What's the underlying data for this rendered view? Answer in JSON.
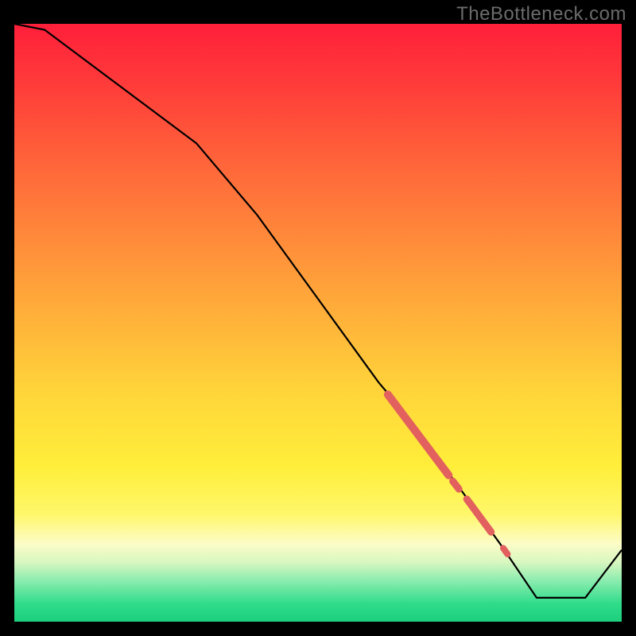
{
  "watermark": "TheBottleneck.com",
  "colors": {
    "line": "#000000",
    "marker": "#e2605e",
    "bg_top": "#ff1f3a",
    "bg_bottom": "#1dcf7e"
  },
  "chart_data": {
    "type": "line",
    "title": "",
    "xlabel": "",
    "ylabel": "",
    "xlim": [
      0,
      100
    ],
    "ylim": [
      0,
      100
    ],
    "x": [
      0,
      5,
      30,
      40,
      50,
      60,
      65,
      70,
      75,
      80,
      82,
      86,
      94,
      100
    ],
    "values": [
      100,
      99,
      80,
      68,
      54,
      40,
      34,
      27,
      20,
      13,
      10,
      4,
      4,
      12
    ],
    "marker_segments": [
      {
        "x0": 61.5,
        "y0": 38.0,
        "x1": 71.5,
        "y1": 24.5,
        "w": 10
      },
      {
        "x0": 72.2,
        "y0": 23.5,
        "x1": 73.2,
        "y1": 22.2,
        "w": 9
      },
      {
        "x0": 74.5,
        "y0": 20.5,
        "x1": 78.5,
        "y1": 15.0,
        "w": 9
      },
      {
        "x0": 80.5,
        "y0": 12.3,
        "x1": 81.2,
        "y1": 11.3,
        "w": 8
      }
    ],
    "annotations": []
  }
}
